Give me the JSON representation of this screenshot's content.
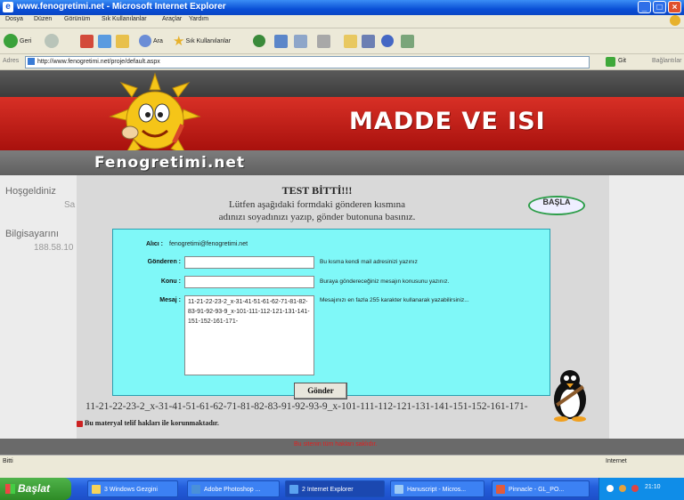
{
  "window": {
    "title": "www.fenogretimi.net - Microsoft Internet Explorer"
  },
  "menu": [
    "Dosya",
    "Düzen",
    "Görünüm",
    "Sık Kullanılanlar",
    "Araçlar",
    "Yardım"
  ],
  "toolbar": {
    "back": "Geri",
    "search": "Ara",
    "favorites": "Sık Kullanılanlar"
  },
  "address": {
    "label": "Adres",
    "url": "http://www.fenogretimi.net/proje/default.aspx",
    "go": "Git",
    "links": "Bağlantılar"
  },
  "site": {
    "banner_title": "MADDE VE ISI",
    "brand": "Fenogretimi.net",
    "left": {
      "welcome": "Hoşgeldiniz",
      "welcome_sub": "Sa",
      "computer": "Bilgisayarını",
      "ip": "188.58.10"
    },
    "test": {
      "title": "TEST BİTTİ!!!",
      "line1": "Lütfen aşağıdaki formdaki gönderen kısmına",
      "line2": "adınızı soyadınızı yazıp, gönder butonuna basınız.",
      "start_button": "BAŞLA"
    },
    "form": {
      "alici_label": "Alıcı :",
      "alici_value": "fenogretimi@fenogretimi.net",
      "gonderen_label": "Gönderen :",
      "gonderen_hint": "Bu kısma kendi mail adresinizi yazınız",
      "konu_label": "Konu :",
      "konu_hint": "Buraya göndereceğiniz mesajın konusunu yazınız.",
      "mesaj_label": "Mesaj :",
      "mesaj_value": "11-21-22-23-2_x-31-41-51-61-62-71-81-82-83-91-92-93-9_x-101-111-112-121-131-141-151-152-161-171-",
      "mesaj_hint": "Mesajınızı en fazla 255 karakter kullanarak yazabilirsiniz...",
      "submit": "Gönder"
    },
    "result_sequence": "11-21-22-23-2_x-31-41-51-61-62-71-81-82-83-91-92-93-9_x-101-111-112-121-131-141-151-152-161-171-",
    "copyright": "Bu materyal telif hakları ile korunmaktadır.",
    "footer": "Bu sitenin tüm hakları saklıdır."
  },
  "status": {
    "left": "Bitti",
    "zone": "Internet"
  },
  "taskbar": {
    "start": "Başlat",
    "buttons": [
      "3 Windows Gezgini",
      "Adobe Photoshop ...",
      "2 Internet Explorer",
      "Hanuscript - Micros...",
      "Pinnacle - GL_PO..."
    ],
    "clock": "21:10"
  }
}
